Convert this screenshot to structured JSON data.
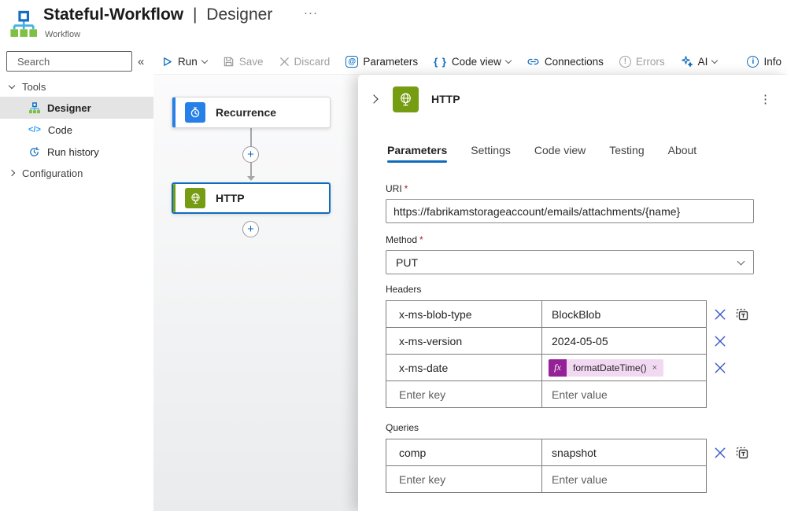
{
  "icons": {
    "more_horizontal": "···",
    "more_vertical": "⋮",
    "collapse_left": "«",
    "braces": "{ }",
    "code": "</>",
    "plus": "+",
    "times_small": "×",
    "fx": "fx",
    "at": "@",
    "info_i": "i",
    "errors_mark": "!"
  },
  "header": {
    "title": "Stateful-Workflow",
    "separator": "|",
    "view_name": "Designer",
    "subtitle": "Workflow"
  },
  "toolbar": {
    "run": "Run",
    "save": "Save",
    "discard": "Discard",
    "parameters": "Parameters",
    "code_view": "Code view",
    "connections": "Connections",
    "errors": "Errors",
    "ai": "AI",
    "info": "Info"
  },
  "sidebar": {
    "search_placeholder": "Search",
    "tools_label": "Tools",
    "items": [
      {
        "label": "Designer",
        "selected": true
      },
      {
        "label": "Code",
        "selected": false
      },
      {
        "label": "Run history",
        "selected": false
      }
    ],
    "configuration_label": "Configuration"
  },
  "canvas": {
    "nodes": [
      {
        "label": "Recurrence",
        "icon": "recurrence-clock",
        "color": "#2680e8",
        "selected": false
      },
      {
        "label": "HTTP",
        "icon": "globe",
        "color": "#769c12",
        "selected": true
      }
    ]
  },
  "panel": {
    "title": "HTTP",
    "required_mark": "*",
    "tabs": [
      {
        "label": "Parameters",
        "active": true
      },
      {
        "label": "Settings",
        "active": false
      },
      {
        "label": "Code view",
        "active": false
      },
      {
        "label": "Testing",
        "active": false
      },
      {
        "label": "About",
        "active": false
      }
    ],
    "uri": {
      "label": "URI",
      "value": "https://fabrikamstorageaccount/emails/attachments/{name}"
    },
    "method": {
      "label": "Method",
      "value": "PUT"
    },
    "headers": {
      "label": "Headers",
      "rows": [
        {
          "key": "x-ms-blob-type",
          "value": "BlockBlob"
        },
        {
          "key": "x-ms-version",
          "value": "2024-05-05"
        },
        {
          "key": "x-ms-date",
          "token": "formatDateTime()"
        }
      ],
      "key_placeholder": "Enter key",
      "value_placeholder": "Enter value"
    },
    "queries": {
      "label": "Queries",
      "rows": [
        {
          "key": "comp",
          "value": "snapshot"
        }
      ],
      "key_placeholder": "Enter key",
      "value_placeholder": "Enter value"
    }
  },
  "colors": {
    "accent_blue": "#0f6cbd",
    "http_green": "#769c12",
    "recurrence_blue": "#2680e8",
    "fx_purple": "#942197",
    "required_red": "#a4262c",
    "selected_row_gray": "#e4e4e4"
  }
}
